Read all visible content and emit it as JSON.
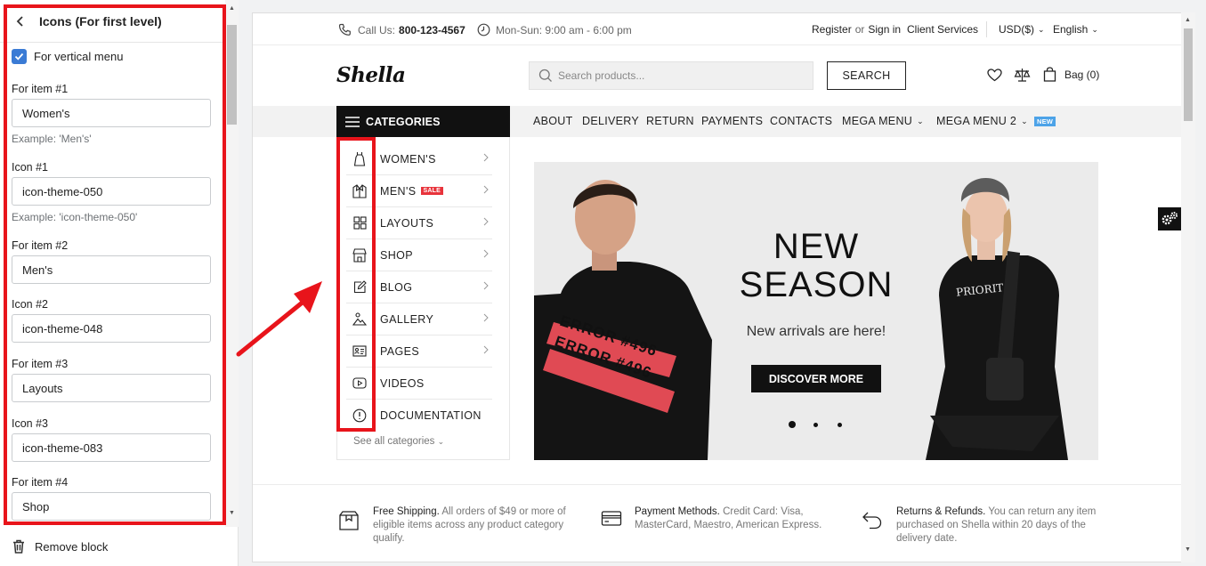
{
  "sidebar": {
    "title": "Icons (For first level)",
    "checkbox_label": "For vertical menu",
    "fields": [
      {
        "label": "For item #1",
        "value": "Women's",
        "help": "Example: 'Men's'"
      },
      {
        "label": "Icon #1",
        "value": "icon-theme-050",
        "help": "Example: 'icon-theme-050'"
      },
      {
        "label": "For item #2",
        "value": "Men's"
      },
      {
        "label": "Icon #2",
        "value": "icon-theme-048"
      },
      {
        "label": "For item #3",
        "value": "Layouts"
      },
      {
        "label": "Icon #3",
        "value": "icon-theme-083"
      },
      {
        "label": "For item #4",
        "value": "Shop"
      }
    ],
    "remove_label": "Remove block"
  },
  "store": {
    "topbar": {
      "call_label": "Call Us:",
      "phone": "800-123-4567",
      "hours": "Mon-Sun: 9:00 am - 6:00 pm",
      "register": "Register",
      "or": "or",
      "signin": "Sign in",
      "client_services": "Client Services",
      "currency": "USD($)",
      "language": "English"
    },
    "logo": "Shella",
    "search": {
      "placeholder": "Search products...",
      "button": "SEARCH"
    },
    "bag": "Bag (0)",
    "categories_label": "CATEGORIES",
    "menu": [
      "ABOUT",
      "DELIVERY",
      "RETURN",
      "PAYMENTS",
      "CONTACTS",
      "MEGA MENU",
      "MEGA MENU 2"
    ],
    "new_badge": "NEW",
    "categories": [
      {
        "label": "WOMEN'S",
        "icon": "dress-icon"
      },
      {
        "label": "MEN'S",
        "icon": "shirt-icon",
        "badge": "SALE"
      },
      {
        "label": "LAYOUTS",
        "icon": "grid-icon"
      },
      {
        "label": "SHOP",
        "icon": "store-icon"
      },
      {
        "label": "BLOG",
        "icon": "edit-icon"
      },
      {
        "label": "GALLERY",
        "icon": "image-icon"
      },
      {
        "label": "PAGES",
        "icon": "id-card-icon"
      },
      {
        "label": "VIDEOS",
        "icon": "play-icon"
      },
      {
        "label": "DOCUMENTATION",
        "icon": "info-icon"
      }
    ],
    "see_all": "See all categories",
    "banner": {
      "line1": "NEW",
      "line2": "SEASON",
      "sub": "New arrivals are here!",
      "button": "DISCOVER MORE",
      "shirt_text1": "ERROR #496",
      "shirt_text2": "ERROR #496",
      "shirt_text3": "PRIORIT",
      "active_slide": 1,
      "slide_count": 3
    },
    "features": [
      {
        "title": "Free Shipping.",
        "text": " All orders of $49 or more of eligible items across any product category qualify."
      },
      {
        "title": "Payment Methods.",
        "text": " Credit Card: Visa, MasterCard, Maestro, American Express."
      },
      {
        "title": "Returns & Refunds.",
        "text": " You can return any item purchased on Shella within 20 days of the delivery date."
      }
    ]
  },
  "colors": {
    "highlight": "#e8141b",
    "accent": "#3a7bd5",
    "sale": "#e8333b",
    "new": "#4da3e8"
  }
}
